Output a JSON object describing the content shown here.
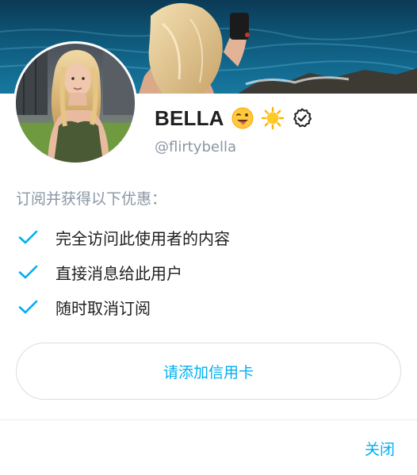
{
  "profile": {
    "name": "BELLA",
    "handle": "@flirtybella",
    "name_emojis": [
      "winking-tongue-emoji",
      "sun-emoji"
    ],
    "verified": true
  },
  "benefits": {
    "title": "订阅并获得以下优惠：",
    "items": [
      "完全访问此使用者的内容",
      "直接消息给此用户",
      "随时取消订阅"
    ]
  },
  "actions": {
    "add_card_label": "请添加信用卡",
    "close_label": "关闭"
  },
  "colors": {
    "accent": "#00aff0",
    "muted_text": "#8a96a3",
    "primary_text": "#1f1f1f",
    "border": "#d9dde2"
  }
}
